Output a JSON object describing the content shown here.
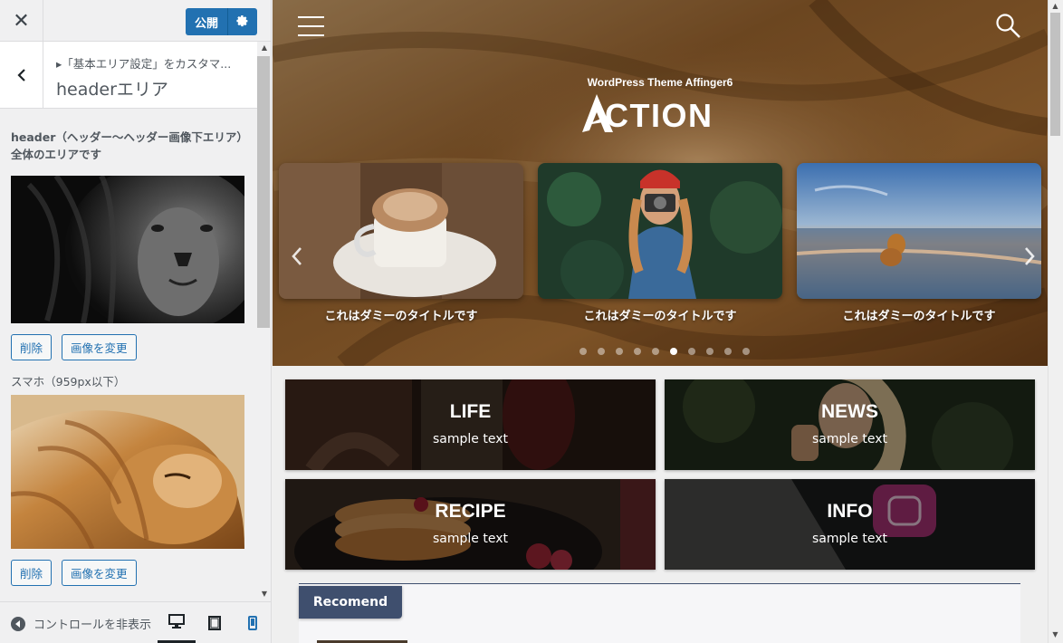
{
  "customizer": {
    "close_label": "✕",
    "publish_label": "公開",
    "breadcrumb": "▸「基本エリア設定」をカスタマ...",
    "section_title": "headerエリア",
    "control_description": "header（ヘッダー〜ヘッダー画像下エリア）全体のエリアです",
    "pc_image_buttons": {
      "remove": "削除",
      "change": "画像を変更"
    },
    "sp_label": "スマホ（959px以下）",
    "sp_image_buttons": {
      "remove": "削除",
      "change": "画像を変更"
    },
    "collapse_label": "コントロールを非表示",
    "devices": [
      "desktop",
      "tablet",
      "mobile"
    ],
    "active_device": "desktop"
  },
  "preview": {
    "theme_subtitle": "WordPress Theme Affinger6",
    "logo_text": "CTION",
    "slides": [
      {
        "title": "これはダミーのタイトルです",
        "image": "coffee-cup"
      },
      {
        "title": "これはダミーのタイトルです",
        "image": "woman-camera"
      },
      {
        "title": "これはダミーのタイトルです",
        "image": "dog-beach-sunset"
      }
    ],
    "slider_dots": 10,
    "slider_active_dot": 5,
    "cards": [
      {
        "title": "LIFE",
        "subtitle": "sample text"
      },
      {
        "title": "NEWS",
        "subtitle": "sample text"
      },
      {
        "title": "RECIPE",
        "subtitle": "sample text"
      },
      {
        "title": "INFO",
        "subtitle": "sample text"
      }
    ],
    "recomend_label": "Recomend"
  },
  "colors": {
    "wp_blue": "#2271b1",
    "recomend_tab": "#3f4f6e",
    "sidebar_bg": "#f0f0f1"
  }
}
